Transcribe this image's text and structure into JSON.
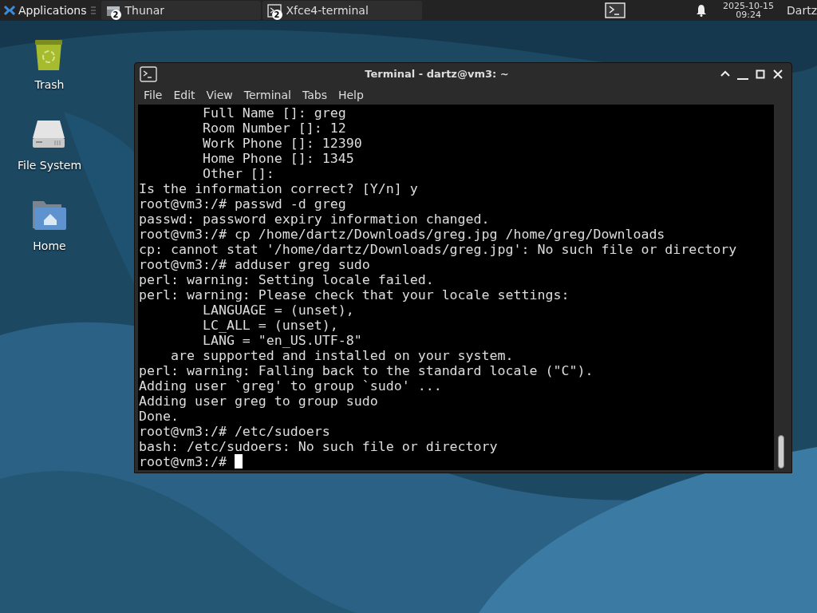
{
  "panel": {
    "applications": "Applications",
    "tasks": [
      {
        "label": "Thunar",
        "badge": "2",
        "kind": "folder",
        "selected": false
      },
      {
        "label": "Xfce4-terminal",
        "badge": "2",
        "kind": "terminal",
        "selected": false
      }
    ],
    "date": "2025-10-15",
    "time": "09:24",
    "user": "Dartz"
  },
  "desktop_icons": [
    {
      "label": "Trash",
      "kind": "trash"
    },
    {
      "label": "File System",
      "kind": "drive"
    },
    {
      "label": "Home",
      "kind": "home"
    }
  ],
  "terminal": {
    "title": "Terminal - dartz@vm3: ~",
    "menu": [
      "File",
      "Edit",
      "View",
      "Terminal",
      "Tabs",
      "Help"
    ],
    "lines": [
      "        Full Name []: greg",
      "        Room Number []: 12",
      "        Work Phone []: 12390",
      "        Home Phone []: 1345",
      "        Other []:",
      "Is the information correct? [Y/n] y",
      "root@vm3:/# passwd -d greg",
      "passwd: password expiry information changed.",
      "root@vm3:/# cp /home/dartz/Downloads/greg.jpg /home/greg/Downloads",
      "cp: cannot stat '/home/dartz/Downloads/greg.jpg': No such file or directory",
      "root@vm3:/# adduser greg sudo",
      "perl: warning: Setting locale failed.",
      "perl: warning: Please check that your locale settings:",
      "        LANGUAGE = (unset),",
      "        LC_ALL = (unset),",
      "        LANG = \"en_US.UTF-8\"",
      "    are supported and installed on your system.",
      "perl: warning: Falling back to the standard locale (\"C\").",
      "Adding user `greg' to group `sudo' ...",
      "Adding user greg to group sudo",
      "Done.",
      "root@vm3:/# /etc/sudoers",
      "bash: /etc/sudoers: No such file or directory",
      "root@vm3:/#"
    ],
    "cursor": true
  }
}
